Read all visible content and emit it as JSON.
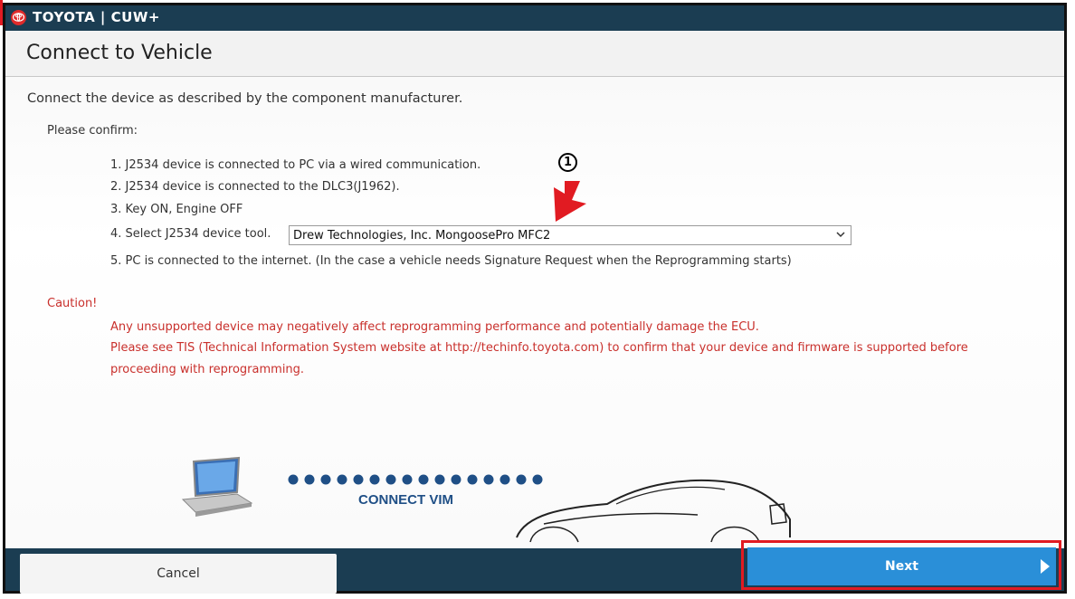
{
  "app": {
    "brand": "TOYOTA | CUW+"
  },
  "page": {
    "title": "Connect to Vehicle",
    "instruction": "Connect the device as described by the component manufacturer.",
    "confirm_label": "Please confirm:"
  },
  "steps": {
    "s1": "1. J2534 device is connected to PC via a wired communication.",
    "s2": "2. J2534 device is connected to the DLC3(J1962).",
    "s3": "3. Key ON, Engine OFF",
    "s4_label": "4. Select J2534 device tool.",
    "s5": "5. PC is connected to the internet. (In the case a vehicle needs Signature Request when the Reprogramming starts)"
  },
  "device_select": {
    "selected": "Drew Technologies, Inc. MongoosePro MFC2"
  },
  "caution": {
    "title": "Caution!",
    "line1": "Any unsupported device may negatively affect reprogramming performance and potentially damage the ECU.",
    "line2": "Please see TIS (Technical Information System website at http://techinfo.toyota.com) to confirm that your device and firmware is supported before",
    "line3": "proceeding with reprogramming."
  },
  "annotation": {
    "number": "1"
  },
  "illustration": {
    "label": "CONNECT VIM"
  },
  "footer": {
    "cancel": "Cancel",
    "next": "Next"
  },
  "colors": {
    "header": "#1b3d52",
    "next": "#2a8fd8",
    "caution": "#c9302c",
    "highlight": "#e11b22"
  },
  "icons": [
    "toyota-logo-icon",
    "chevron-down-icon",
    "red-arrow-icon",
    "laptop-icon",
    "car-icon",
    "next-arrow-icon"
  ]
}
